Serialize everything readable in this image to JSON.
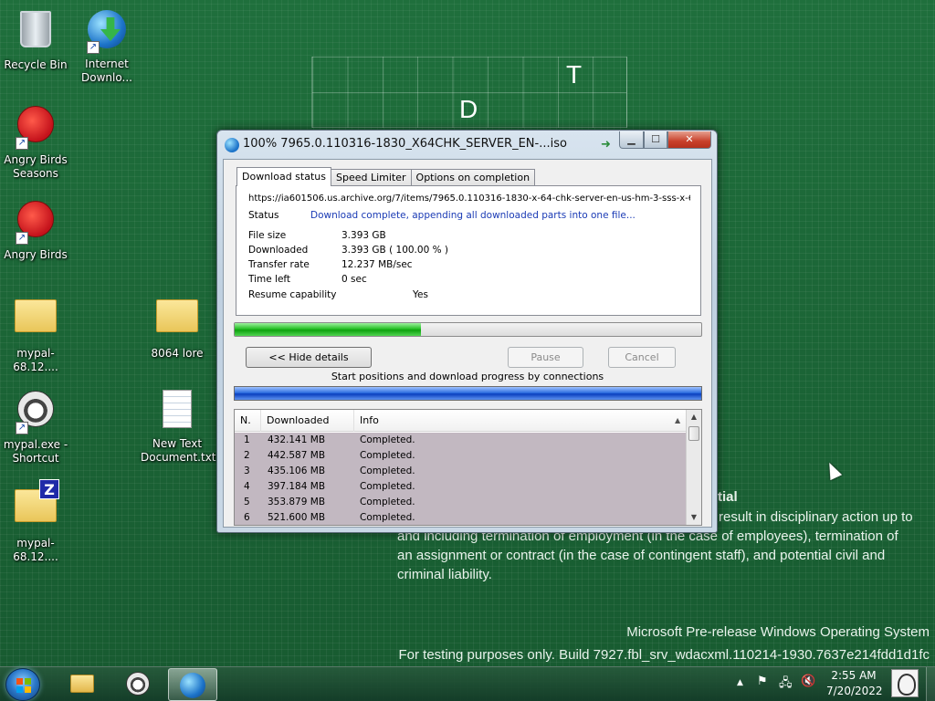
{
  "desktop": {
    "icons": [
      {
        "label": "Recycle Bin",
        "icon": "recycle-bin-icon"
      },
      {
        "label": "Internet Downlo...",
        "icon": "idm-globe-icon"
      },
      {
        "label": "Angry Birds Seasons",
        "icon": "angry-birds-icon"
      },
      {
        "label": "Angry Birds",
        "icon": "angry-birds-icon"
      },
      {
        "label": "mypal-68.12....",
        "icon": "folder-icon"
      },
      {
        "label": "8064 lore",
        "icon": "folder-icon"
      },
      {
        "label": "mypal.exe - Shortcut",
        "icon": "raccoon-icon"
      },
      {
        "label": "New Text Document.txt",
        "icon": "text-document-icon"
      },
      {
        "label": "mypal-68.12....",
        "icon": "zip-folder-icon"
      }
    ],
    "grid_letters": [
      "T",
      "D"
    ]
  },
  "watermark": {
    "confidential_heading": "tial",
    "confidential_line1": "result in disciplinary action up to",
    "confidential_line2": "and including termination of employment (in the case of employees), termination of",
    "confidential_line3": "an assignment or contract (in the case of contingent staff), and potential civil and",
    "confidential_line4": "criminal liability.",
    "os_name": "Microsoft Pre-release Windows Operating System",
    "build": "For testing purposes only. Build 7927.fbl_srv_wdacxml.110214-1930.7637e214fdd1d1fc"
  },
  "window": {
    "title": "100% 7965.0.110316-1830_X64CHK_SERVER_EN-...iso",
    "tabs": [
      {
        "label": "Download status",
        "active": true
      },
      {
        "label": "Speed Limiter",
        "active": false
      },
      {
        "label": "Options on completion",
        "active": false
      }
    ],
    "url": "https://ia601506.us.archive.org/7/items/7965.0.110316-1830-x-64-chk-server-en-us-hm-3-sss-x-64",
    "status_label": "Status",
    "status_value": "Download complete, appending all downloaded parts into one file...",
    "file_size_label": "File size",
    "file_size_value": "3.393  GB",
    "downloaded_label": "Downloaded",
    "downloaded_value": "3.393  GB  ( 100.00 % )",
    "transfer_rate_label": "Transfer rate",
    "transfer_rate_value": "12.237  MB/sec",
    "time_left_label": "Time left",
    "time_left_value": "0 sec",
    "resume_label": "Resume capability",
    "resume_value": "Yes",
    "progress_fraction": 0.4,
    "hide_details_label": "<< Hide details",
    "pause_label": "Pause",
    "cancel_label": "Cancel",
    "connections_caption": "Start positions and download progress by connections",
    "table": {
      "headers": {
        "n": "N.",
        "downloaded": "Downloaded",
        "info": "Info"
      },
      "rows": [
        {
          "n": "1",
          "downloaded": "432.141  MB",
          "info": "Completed."
        },
        {
          "n": "2",
          "downloaded": "442.587  MB",
          "info": "Completed."
        },
        {
          "n": "3",
          "downloaded": "435.106  MB",
          "info": "Completed."
        },
        {
          "n": "4",
          "downloaded": "397.184  MB",
          "info": "Completed."
        },
        {
          "n": "5",
          "downloaded": "353.879  MB",
          "info": "Completed."
        },
        {
          "n": "6",
          "downloaded": "521.600  MB",
          "info": "Completed."
        }
      ]
    }
  },
  "taskbar": {
    "clock_time": "2:55 AM",
    "clock_date": "7/20/2022",
    "colors": {
      "accent": "#1e6b3a"
    }
  }
}
